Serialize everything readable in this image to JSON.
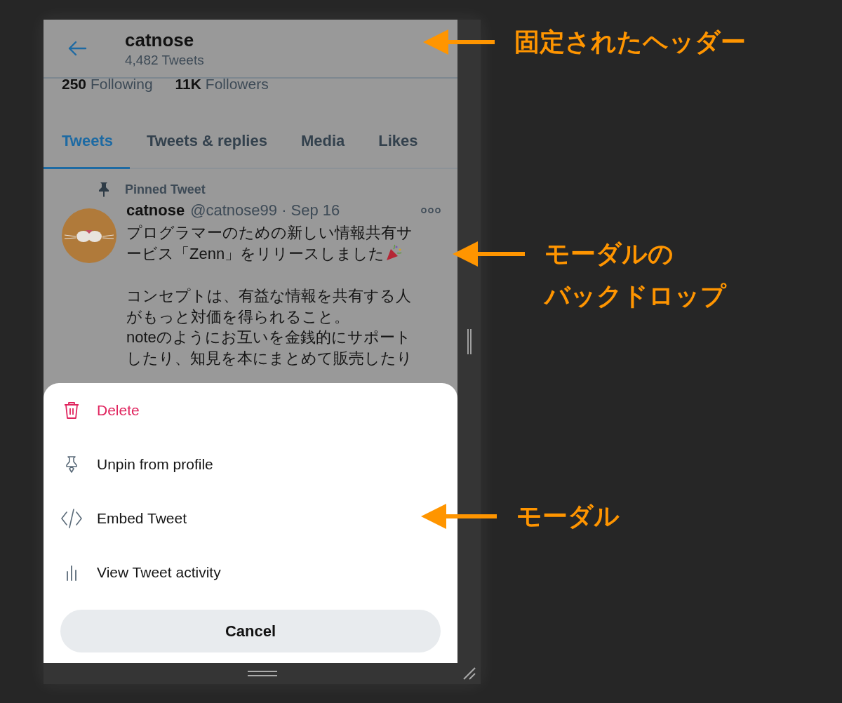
{
  "header": {
    "name": "catnose",
    "tweet_count": "4,482 Tweets"
  },
  "stats": [
    {
      "count": "250",
      "label": "Following"
    },
    {
      "count": "11K",
      "label": "Followers"
    }
  ],
  "tabs": [
    {
      "label": "Tweets",
      "selected": true
    },
    {
      "label": "Tweets & replies",
      "selected": false
    },
    {
      "label": "Media",
      "selected": false
    },
    {
      "label": "Likes",
      "selected": false
    }
  ],
  "pinned_tweet": {
    "label": "Pinned Tweet",
    "author": "catnose",
    "handle": "@catnose99",
    "date": "Sep 16",
    "separator": "·",
    "paragraphs": [
      [
        "プログラマーのための新しい情報共有サ",
        "ービス「Zenn」をリリースしました"
      ],
      [
        "コンセプトは、有益な情報を共有する人",
        "がもっと対価を得られること。",
        "noteのようにお互いを金銭的にサポート",
        "したり、知見を本にまとめて販売したり"
      ]
    ]
  },
  "modal": {
    "items": [
      {
        "kind": "delete",
        "label": "Delete",
        "destructive": true
      },
      {
        "kind": "unpin",
        "label": "Unpin from profile",
        "destructive": false
      },
      {
        "kind": "embed",
        "label": "Embed Tweet",
        "destructive": false
      },
      {
        "kind": "activity",
        "label": "View Tweet activity",
        "destructive": false
      }
    ],
    "cancel": "Cancel"
  },
  "annotations": [
    {
      "lines": [
        "固定されたヘッダー"
      ]
    },
    {
      "lines": [
        "モーダルの",
        "バックドロップ"
      ]
    },
    {
      "lines": [
        "モーダル"
      ]
    }
  ]
}
